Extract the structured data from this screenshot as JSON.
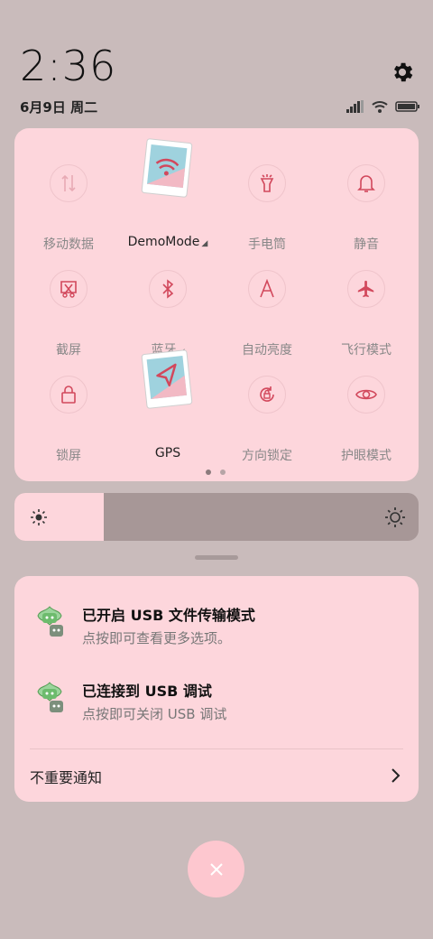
{
  "status": {
    "time": "2:36",
    "date": "6月9日 周二"
  },
  "quick_settings": {
    "tiles": [
      {
        "label": "移动数据",
        "icon": "mobile-data-icon",
        "state": "off"
      },
      {
        "label": "DemoMode",
        "icon": "wifi-icon",
        "state": "on",
        "caret": "◢"
      },
      {
        "label": "手电筒",
        "icon": "flashlight-icon",
        "state": "off"
      },
      {
        "label": "静音",
        "icon": "bell-icon",
        "state": "off"
      },
      {
        "label": "截屏",
        "icon": "screenshot-icon",
        "state": "off"
      },
      {
        "label": "蓝牙",
        "icon": "bluetooth-icon",
        "state": "off",
        "caret": "◢"
      },
      {
        "label": "自动亮度",
        "icon": "auto-brightness-icon",
        "state": "off"
      },
      {
        "label": "飞行模式",
        "icon": "airplane-icon",
        "state": "off"
      },
      {
        "label": "锁屏",
        "icon": "lock-icon",
        "state": "off"
      },
      {
        "label": "GPS",
        "icon": "location-arrow-icon",
        "state": "on"
      },
      {
        "label": "方向锁定",
        "icon": "rotation-lock-icon",
        "state": "off"
      },
      {
        "label": "护眼模式",
        "icon": "eye-icon",
        "state": "off"
      }
    ],
    "page_indicator": {
      "current": 1,
      "total": 2
    }
  },
  "brightness": {
    "level": 0.22
  },
  "notifications": {
    "items": [
      {
        "title": "已开启 USB 文件传输模式",
        "subtitle": "点按即可查看更多选项。",
        "icon": "android-usb-icon"
      },
      {
        "title": "已连接到 USB 调试",
        "subtitle": "点按即可关闭 USB 调试",
        "icon": "android-usb-icon"
      }
    ],
    "unimportant_label": "不重要通知"
  },
  "colors": {
    "background": "#c9bbbb",
    "panel": "#fdd6dc",
    "accent": "#d2485c",
    "icon_outline": "#c7505f"
  }
}
